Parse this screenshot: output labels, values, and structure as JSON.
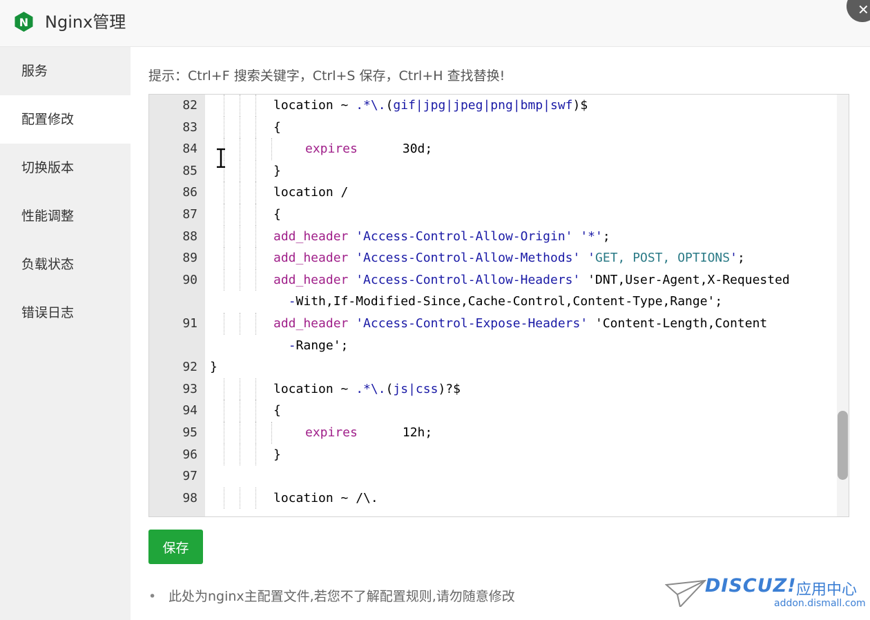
{
  "window": {
    "title": "Nginx管理",
    "logo_letter": "N",
    "close_symbol": "✕"
  },
  "sidebar": {
    "items": [
      {
        "label": "服务"
      },
      {
        "label": "配置修改",
        "active": true
      },
      {
        "label": "切换版本"
      },
      {
        "label": "性能调整"
      },
      {
        "label": "负载状态"
      },
      {
        "label": "错误日志"
      }
    ]
  },
  "main": {
    "hint": "提示：Ctrl+F 搜索关键字，Ctrl+S 保存，Ctrl+H 查找替换!",
    "save_label": "保存",
    "note": "此处为nginx主配置文件,若您不了解配置规则,请勿随意修改"
  },
  "editor": {
    "lines": [
      {
        "n": "82",
        "guides": 3,
        "text": "location ~ .*\\.(gif|jpg|jpeg|png|bmp|swf)$"
      },
      {
        "n": "83",
        "guides": 3,
        "text": "{"
      },
      {
        "n": "84",
        "guides": 4,
        "text": "expires      30d;"
      },
      {
        "n": "85",
        "guides": 3,
        "text": "}"
      },
      {
        "n": "86",
        "guides": 3,
        "text": "location /"
      },
      {
        "n": "87",
        "guides": 3,
        "text": "{"
      },
      {
        "n": "88",
        "guides": 3,
        "text": "add_header 'Access-Control-Allow-Origin' '*';"
      },
      {
        "n": "89",
        "guides": 3,
        "text": "add_header 'Access-Control-Allow-Methods' 'GET, POST, OPTIONS';"
      },
      {
        "n": "90",
        "guides": 3,
        "text": "add_header 'Access-Control-Allow-Headers' 'DNT,User-Agent,X-Requested"
      },
      {
        "n": "",
        "guides": 0,
        "text": "  -With,If-Modified-Since,Cache-Control,Content-Type,Range';"
      },
      {
        "n": "91",
        "guides": 3,
        "text": "add_header 'Access-Control-Expose-Headers' 'Content-Length,Content"
      },
      {
        "n": "",
        "guides": 0,
        "text": "  -Range';"
      },
      {
        "n": "92",
        "guides": 0,
        "text": "}"
      },
      {
        "n": "93",
        "guides": 3,
        "text": "location ~ .*\\.(js|css)?$"
      },
      {
        "n": "94",
        "guides": 3,
        "text": "{"
      },
      {
        "n": "95",
        "guides": 4,
        "text": "expires      12h;"
      },
      {
        "n": "96",
        "guides": 3,
        "text": "}"
      },
      {
        "n": "97",
        "guides": 0,
        "text": ""
      },
      {
        "n": "98",
        "guides": 3,
        "text": "location ~ /\\."
      }
    ]
  },
  "watermark": {
    "brand": "DISCUZ!",
    "cn": "应用中心",
    "url": "addon.dismall.com"
  },
  "colors": {
    "save_button": "#20a53a",
    "nginx_logo": "#16913a",
    "keyword": "#a0208a",
    "string": "#1a1aa6",
    "watermark": "#3c7fd4"
  }
}
